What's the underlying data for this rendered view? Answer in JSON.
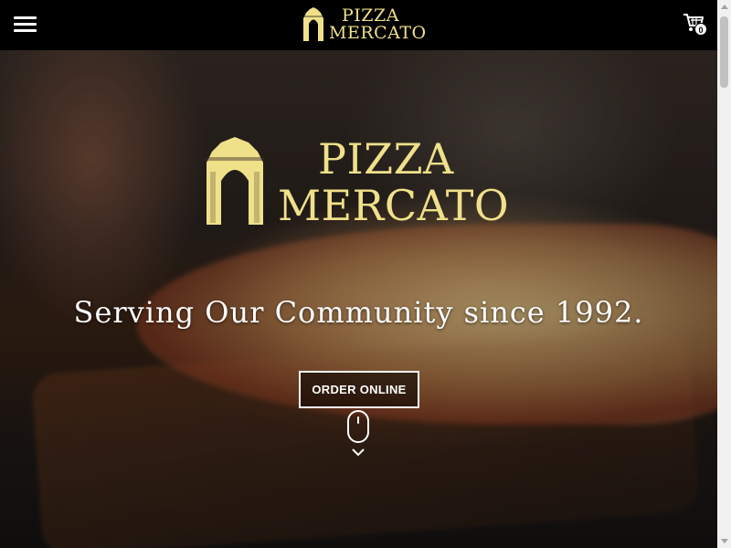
{
  "header": {
    "menu_icon": "hamburger-menu-icon",
    "logo": {
      "line1": "PIZZA",
      "line2": "MERCATO",
      "icon": "arch-icon"
    },
    "cart": {
      "icon": "shopping-cart-icon",
      "count": "0"
    }
  },
  "hero": {
    "logo": {
      "line1": "PIZZA",
      "line2": "MERCATO",
      "icon": "arch-icon"
    },
    "title": "Serving Our Community since 1992.",
    "order_button": "ORDER ONLINE",
    "scroll_icon": "scroll-mouse-icon",
    "chevron_icon": "chevron-down-icon"
  },
  "colors": {
    "brand_gold": "#efe08a",
    "header_bg": "#000000",
    "text_white": "#ffffff"
  }
}
